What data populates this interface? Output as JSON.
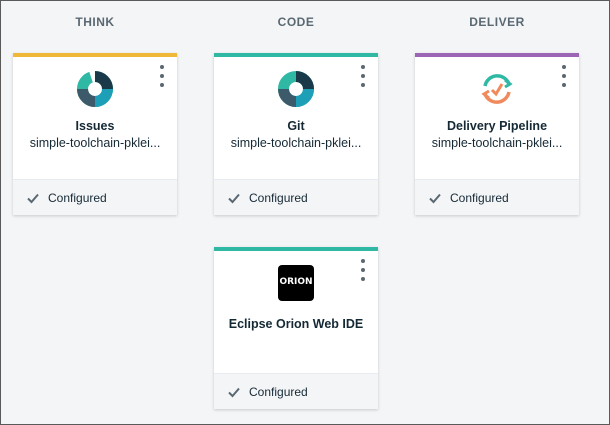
{
  "columns": [
    {
      "label": "THINK"
    },
    {
      "label": "CODE"
    },
    {
      "label": "DELIVER"
    }
  ],
  "cards": [
    {
      "name": "Issues",
      "subtitle": "simple-toolchain-pklei...",
      "status": "Configured",
      "accent": "#f0b839",
      "icon": "issues-donut-icon"
    },
    {
      "name": "Git",
      "subtitle": "simple-toolchain-pklei...",
      "status": "Configured",
      "accent": "#2fb9a5",
      "icon": "git-donut-icon"
    },
    {
      "name": "Delivery Pipeline",
      "subtitle": "simple-toolchain-pklei...",
      "status": "Configured",
      "accent": "#9b66b3",
      "icon": "pipeline-cycle-icon"
    },
    {
      "name": "Eclipse Orion Web IDE",
      "status": "Configured",
      "accent": "#2fb9a5",
      "icon": "orion-logo-icon",
      "logo_text": "ORION"
    }
  ],
  "colors": {
    "think": "#f0b839",
    "code": "#2fb9a5",
    "deliver": "#9b66b3",
    "background": "#f4f5f7",
    "card": "#ffffff"
  }
}
